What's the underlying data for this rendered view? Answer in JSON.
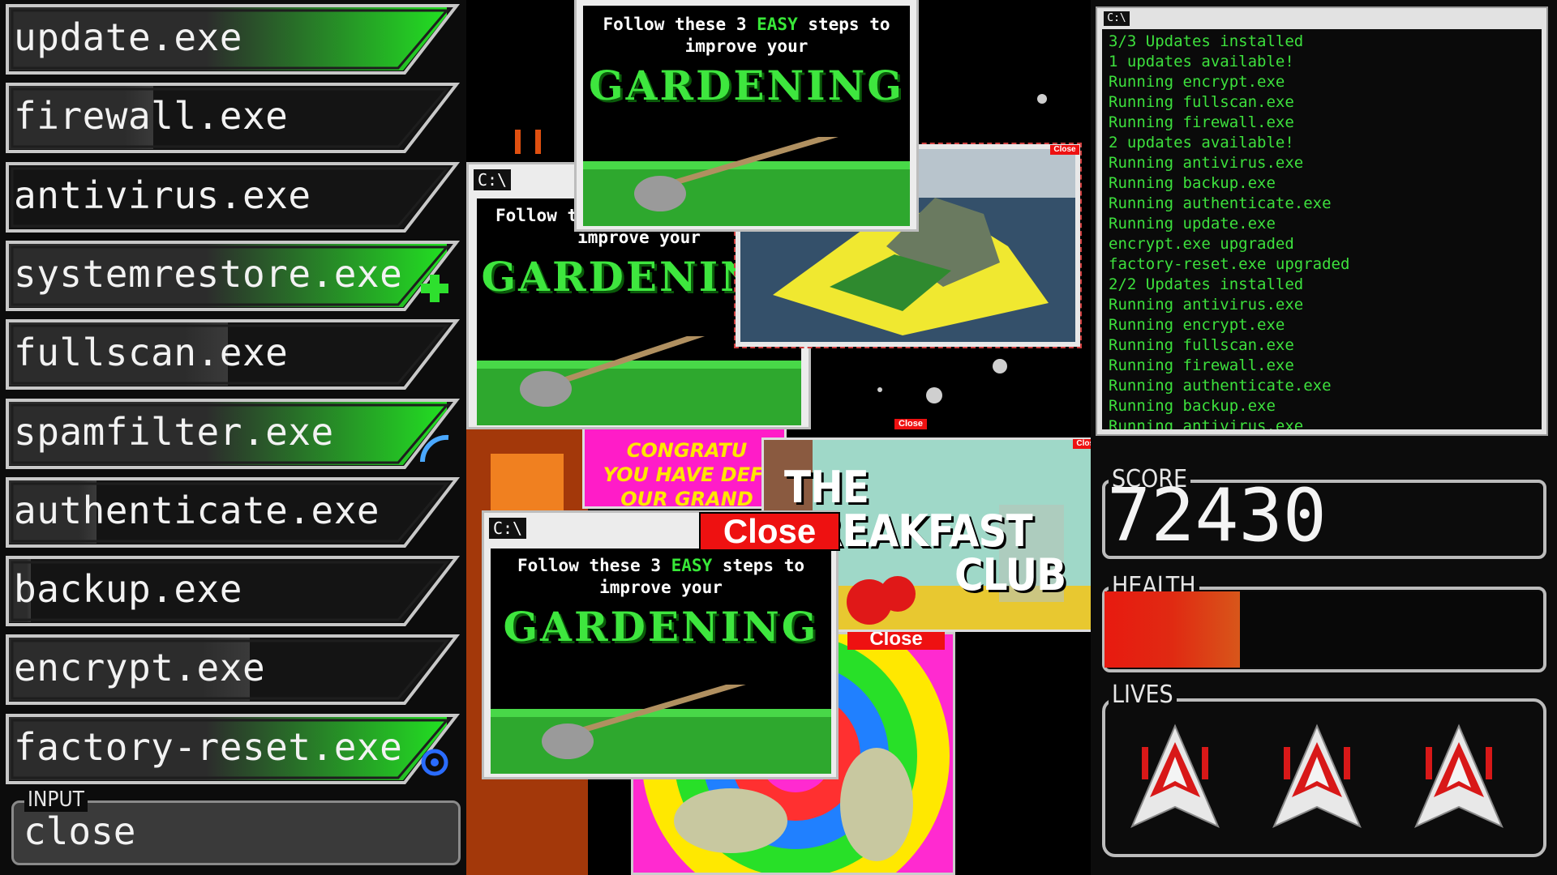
{
  "programs": [
    {
      "name": "update.exe",
      "progress": 1.0,
      "icon": "none"
    },
    {
      "name": "firewall.exe",
      "progress": 0.33,
      "icon": "none"
    },
    {
      "name": "antivirus.exe",
      "progress": 0.0,
      "icon": "none"
    },
    {
      "name": "systemrestore.exe",
      "progress": 1.0,
      "icon": "plus-icon"
    },
    {
      "name": "fullscan.exe",
      "progress": 0.5,
      "icon": "none"
    },
    {
      "name": "spamfilter.exe",
      "progress": 1.0,
      "icon": "shield-arc-icon"
    },
    {
      "name": "authenticate.exe",
      "progress": 0.2,
      "icon": "none"
    },
    {
      "name": "backup.exe",
      "progress": 0.05,
      "icon": "none"
    },
    {
      "name": "encrypt.exe",
      "progress": 0.55,
      "icon": "none"
    },
    {
      "name": "factory-reset.exe",
      "progress": 1.0,
      "icon": "reset-icon"
    }
  ],
  "input": {
    "label": "INPUT",
    "value": "close"
  },
  "popups": {
    "gardening": {
      "title_icon": "C:\\",
      "line1_a": "Follow these 3 ",
      "line1_easy": "EASY",
      "line1_b": " steps to",
      "line2": "improve your",
      "title": "GARDENING"
    },
    "congrats": {
      "lines": [
        "CONGRATU",
        "YOU HAVE DEFI",
        "OUR GRAND"
      ]
    },
    "breakfast": {
      "line1": "THE",
      "line2": "REAKFAST",
      "line3": "CLUB"
    },
    "close_label": "Close",
    "close_small": "Close"
  },
  "terminal": {
    "title_icon": "C:\\",
    "lines": [
      "3/3 Updates installed",
      "1 updates available!",
      "Running encrypt.exe",
      "Running fullscan.exe",
      "Running firewall.exe",
      "2 updates available!",
      "Running antivirus.exe",
      "Running backup.exe",
      "Running authenticate.exe",
      "Running update.exe",
      "encrypt.exe upgraded",
      "factory-reset.exe upgraded",
      "2/2 Updates installed",
      "Running antivirus.exe",
      "Running encrypt.exe",
      "Running fullscan.exe",
      "Running firewall.exe",
      "Running authenticate.exe",
      "Running backup.exe",
      "Running antivirus.exe_"
    ]
  },
  "hud": {
    "score_label": "SCORE",
    "score": "72430",
    "health_label": "HEALTH",
    "health": 0.31,
    "lives_label": "LIVES",
    "lives": 3
  },
  "colors": {
    "progress_green": "#22e022",
    "terminal_green": "#3de03d",
    "health_red": "#e81a10",
    "close_red": "#e11111"
  }
}
